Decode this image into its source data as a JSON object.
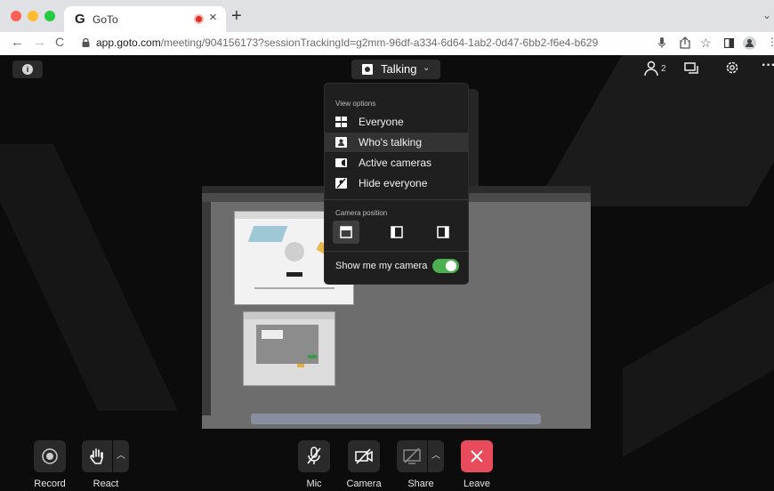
{
  "browser": {
    "tab_favicon": "G",
    "tab_title": "GoTo",
    "tab_close": "×",
    "new_tab": "+",
    "tab_menu": "⌄",
    "url_host": "app.goto.com",
    "url_path": "/meeting/904156173?sessionTrackingId=g2mm-96df-a334-6d64-1ab2-0d47-6bb2-f6e4-b629",
    "back": "←",
    "forward": "→",
    "reload": "C"
  },
  "meeting": {
    "view_button_label": "Talking",
    "participant_count": "2",
    "view_menu": {
      "heading": "View options",
      "items": [
        {
          "label": "Everyone",
          "active": false
        },
        {
          "label": "Who's talking",
          "active": true
        },
        {
          "label": "Active cameras",
          "active": false
        },
        {
          "label": "Hide everyone",
          "active": false
        }
      ],
      "camera_position_heading": "Camera position",
      "show_camera_label": "Show me my camera",
      "show_camera_on": true
    },
    "controls": {
      "record": "Record",
      "react": "React",
      "mic": "Mic",
      "camera": "Camera",
      "share": "Share",
      "leave": "Leave"
    }
  },
  "colors": {
    "toggle_on": "#4caf50",
    "leave_button": "#e84b5b",
    "recording_dot": "#d93025"
  }
}
